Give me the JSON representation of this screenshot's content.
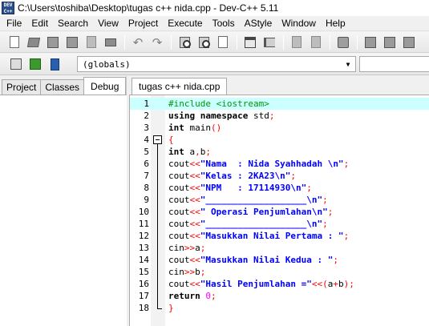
{
  "window": {
    "title": "C:\\Users\\toshiba\\Desktop\\tugas c++ nida.cpp - Dev-C++ 5.11",
    "app_icon_text": "DEV C++"
  },
  "menu": [
    "File",
    "Edit",
    "Search",
    "View",
    "Project",
    "Execute",
    "Tools",
    "AStyle",
    "Window",
    "Help"
  ],
  "toolbar": {
    "globals_value": "(globals)",
    "icons": [
      "new-file-icon",
      "open-file-icon",
      "save-icon",
      "save-all-icon",
      "close-file-icon",
      "print-icon",
      "undo-icon",
      "redo-icon",
      "find-icon",
      "replace-icon",
      "goto-icon",
      "toggle-window-icon",
      "indent-icon",
      "bookmark-icon",
      "compile-icon",
      "run-icon",
      "help-book-icon"
    ]
  },
  "left_panel": {
    "tabs": [
      "Project",
      "Classes",
      "Debug"
    ],
    "active_tab": "Debug"
  },
  "editor": {
    "file_tab": "tugas c++ nida.cpp",
    "current_line": 1,
    "lines": [
      {
        "n": "1",
        "code": "#include <iostream>"
      },
      {
        "n": "2",
        "code": "using namespace std;"
      },
      {
        "n": "3",
        "code": "int main()"
      },
      {
        "n": "4",
        "code": "{"
      },
      {
        "n": "5",
        "code": "int a,b;"
      },
      {
        "n": "6",
        "code": "cout<<\"Nama  : Nida Syahhadah \\n\";"
      },
      {
        "n": "7",
        "code": "cout<<\"Kelas : 2KA23\\n\";"
      },
      {
        "n": "8",
        "code": "cout<<\"NPM   : 17114930\\n\";"
      },
      {
        "n": "9",
        "code": "cout<<\"___________________\\n\";"
      },
      {
        "n": "10",
        "code": "cout<<\" Operasi Penjumlahan\\n\";"
      },
      {
        "n": "11",
        "code": "cout<<\"___________________\\n\";"
      },
      {
        "n": "12",
        "code": "cout<<\"Masukkan Nilai Pertama : \";"
      },
      {
        "n": "13",
        "code": "cin>>a;"
      },
      {
        "n": "14",
        "code": "cout<<\"Masukkan Nilai Kedua : \";"
      },
      {
        "n": "15",
        "code": "cin>>b;"
      },
      {
        "n": "16",
        "code": "cout<<\"Hasil Penjumlahan =\"<<(a+b);"
      },
      {
        "n": "17",
        "code": "return 0;"
      },
      {
        "n": "18",
        "code": "}"
      }
    ]
  },
  "colors": {
    "current_line": "#ccffff",
    "preprocessor": "#009900",
    "string": "#0000ff",
    "symbol": "#ff0000",
    "number": "#ff00ff"
  }
}
